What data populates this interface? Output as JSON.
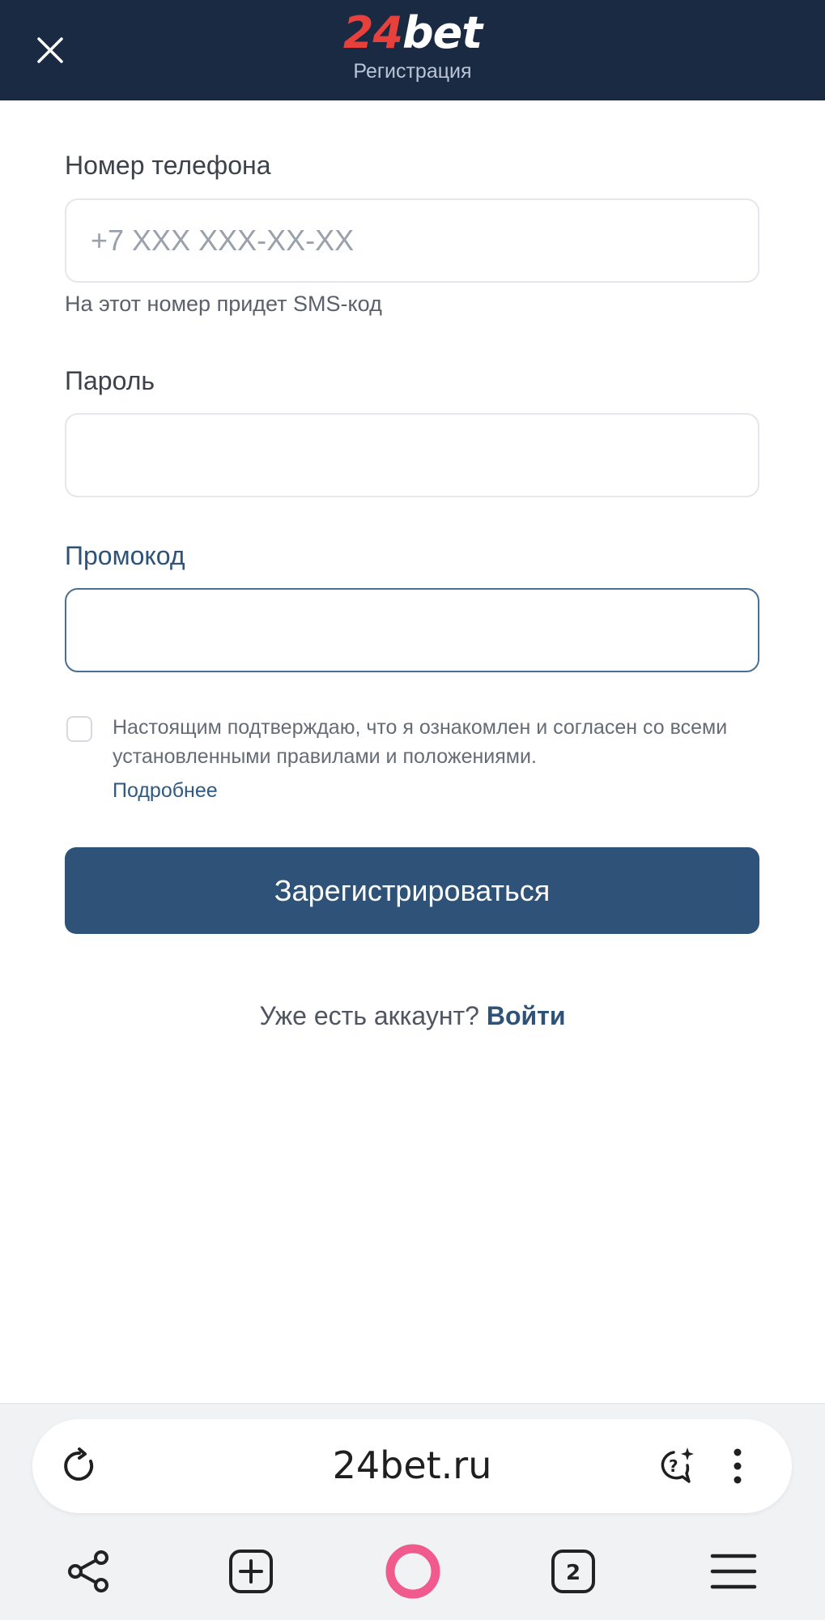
{
  "header": {
    "logo_number": "24",
    "logo_text": "bet",
    "subtitle": "Регистрация"
  },
  "form": {
    "phone": {
      "label": "Номер телефона",
      "placeholder": "+7 XXX XXX-XX-XX",
      "value": "",
      "hint": "На этот номер придет SMS-код"
    },
    "password": {
      "label": "Пароль",
      "value": ""
    },
    "promo": {
      "label": "Промокод",
      "value": ""
    },
    "agreement": {
      "checked": false,
      "text": "Настоящим подтверждаю, что я ознакомлен и согласен со всеми установленными правилами и положениями.",
      "more_link": "Подробнее"
    },
    "submit_label": "Зарегистрироваться",
    "login_prompt": "Уже есть аккаунт?",
    "login_link": "Войти"
  },
  "browser": {
    "url": "24bet.ru",
    "tab_count": "2"
  },
  "colors": {
    "header_bg": "#1b2a43",
    "logo_accent": "#e8413b",
    "primary": "#2f5278",
    "assistant": "#f05a8c"
  },
  "icons": [
    "close-icon",
    "reload-icon",
    "ai-chat-icon",
    "more-vertical-icon",
    "share-icon",
    "new-tab-icon",
    "assistant-icon",
    "tabs-icon",
    "menu-icon"
  ]
}
